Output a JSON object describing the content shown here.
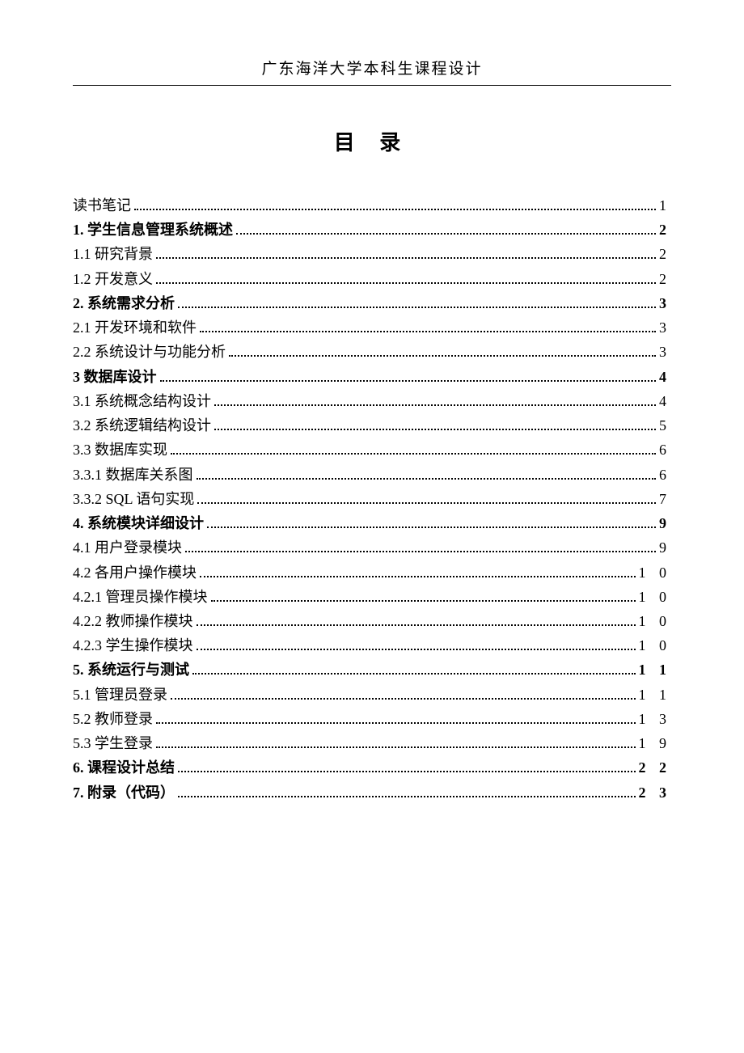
{
  "header": "广东海洋大学本科生课程设计",
  "title": "目 录",
  "toc": [
    {
      "label": "读书笔记 ",
      "page": "1",
      "bold": false
    },
    {
      "label": "1.  学生信息管理系统概述",
      "page": " 2",
      "bold": true
    },
    {
      "label": "1.1  研究背景",
      "page": " 2",
      "bold": false
    },
    {
      "label": "1.2  开发意义",
      "page": " 2",
      "bold": false
    },
    {
      "label": "2.  系统需求分析",
      "page": " 3",
      "bold": true
    },
    {
      "label": "2.1  开发环境和软件",
      "page": " 3",
      "bold": false
    },
    {
      "label": "2.2  系统设计与功能分析",
      "page": " 3",
      "bold": false
    },
    {
      "label": "3   数据库设计",
      "page": " 4",
      "bold": true
    },
    {
      "label": "3.1  系统概念结构设计",
      "page": " 4",
      "bold": false
    },
    {
      "label": "3.2  系统逻辑结构设计",
      "page": " 5",
      "bold": false
    },
    {
      "label": "3.3  数据库实现",
      "page": " 6",
      "bold": false
    },
    {
      "label": "3.3.1  数据库关系图",
      "page": " 6",
      "bold": false
    },
    {
      "label": "3.3.2   SQL 语句实现",
      "page": " 7",
      "bold": false
    },
    {
      "label": "4.  系统模块详细设计",
      "page": " 9",
      "bold": true
    },
    {
      "label": "4.1   用户登录模块",
      "page": " 9",
      "bold": false
    },
    {
      "label": "4.2  各用户操作模块",
      "page": " 1 0",
      "bold": false
    },
    {
      "label": "4.2.1  管理员操作模块",
      "page": " 1 0",
      "bold": false
    },
    {
      "label": "4.2.2  教师操作模块",
      "page": " 1 0",
      "bold": false
    },
    {
      "label": "4.2.3  学生操作模块",
      "page": " 1 0",
      "bold": false
    },
    {
      "label": "5.  系统运行与测试",
      "page": " 1 1",
      "bold": true
    },
    {
      "label": "5.1 管理员登录",
      "page": " 1 1",
      "bold": false
    },
    {
      "label": "5.2 教师登录",
      "page": " 1 3",
      "bold": false
    },
    {
      "label": "5.3 学生登录",
      "page": " 1 9",
      "bold": false
    },
    {
      "label": "6.  课程设计总结",
      "page": " 2 2",
      "bold": true
    },
    {
      "label": "7.  附录（代码）",
      "page": " 2 3",
      "bold": true
    }
  ]
}
